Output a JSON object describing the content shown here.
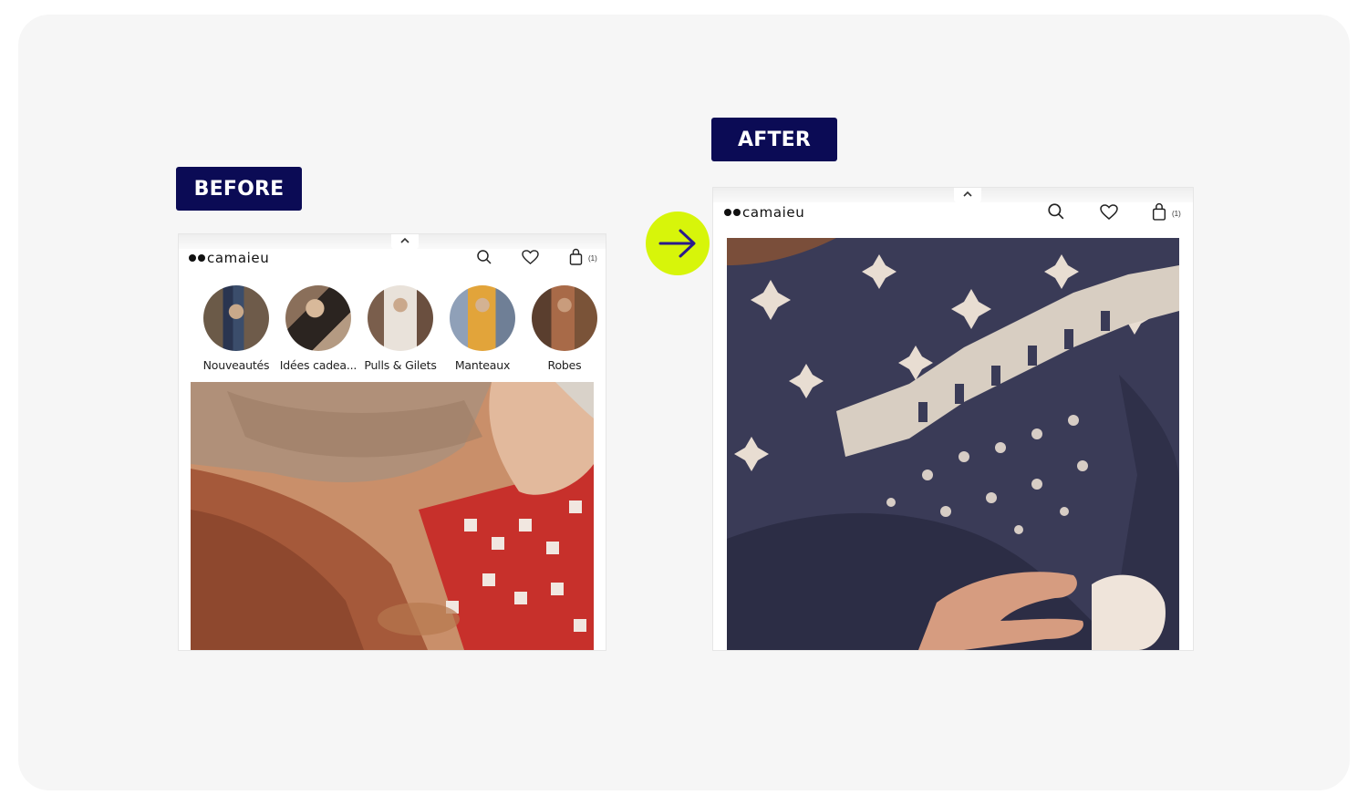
{
  "labels": {
    "before": "BEFORE",
    "after": "AFTER"
  },
  "colors": {
    "label_bg": "#0b0b55",
    "arrow_bg": "#d7f50a",
    "arrow_stroke": "#2a1a8c"
  },
  "before": {
    "logo_text": "camaieu",
    "bag_count": "(1)",
    "icons": [
      "chevron-up-icon",
      "search-icon",
      "heart-icon",
      "shopping-bag-icon"
    ],
    "categories": [
      {
        "label": "Nouveautés"
      },
      {
        "label": "Idées cadea..."
      },
      {
        "label": "Pulls & Gilets"
      },
      {
        "label": "Manteaux"
      },
      {
        "label": "Robes"
      }
    ]
  },
  "after": {
    "logo_text": "camaieu",
    "bag_count": "(1)",
    "icons": [
      "chevron-up-icon",
      "search-icon",
      "heart-icon",
      "shopping-bag-icon"
    ]
  }
}
